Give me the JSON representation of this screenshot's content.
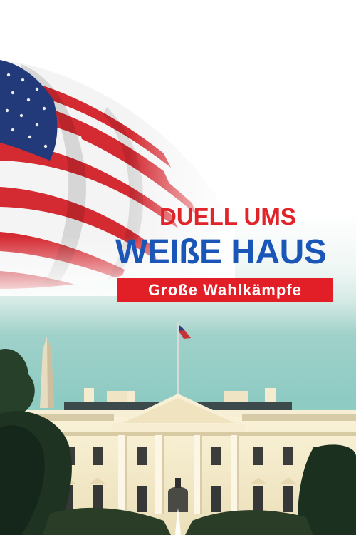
{
  "title": {
    "line1": "DUELL UMS",
    "line2": "WEIßE HAUS",
    "subtitle": "Große Wahlkämpfe"
  },
  "colors": {
    "title_red": "#e0242a",
    "title_blue": "#1a56b8",
    "subtitle_bar": "#e21f26",
    "sky": "#8ecbc3"
  },
  "imagery": {
    "flag": "us-flag-illustration",
    "building": "white-house-illustration",
    "monument": "washington-monument-illustration"
  }
}
